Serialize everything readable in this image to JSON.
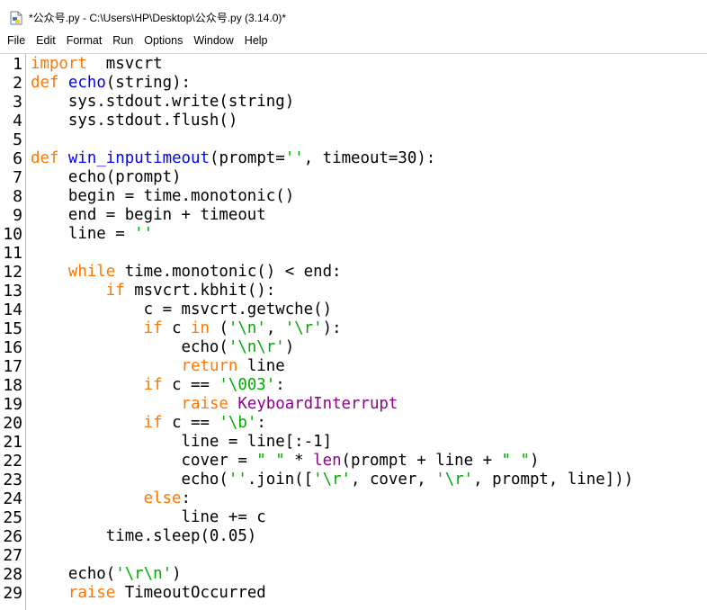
{
  "window": {
    "title": "*公众号.py - C:\\Users\\HP\\Desktop\\公众号.py (3.14.0)*",
    "icon": "python-file-icon"
  },
  "menubar": {
    "items": [
      "File",
      "Edit",
      "Format",
      "Run",
      "Options",
      "Window",
      "Help"
    ]
  },
  "editor": {
    "colors": {
      "keyword": "#ff7700",
      "builtin": "#900090",
      "string": "#00aa00",
      "definition": "#0000ff",
      "text": "#000000"
    },
    "lines": [
      [
        [
          "kw",
          "import"
        ],
        [
          "",
          "  msvcrt"
        ]
      ],
      [
        [
          "kw",
          "def"
        ],
        [
          "",
          " "
        ],
        [
          "df",
          "echo"
        ],
        [
          "",
          "(string):"
        ]
      ],
      [
        [
          "",
          "    sys.stdout.write(string)"
        ]
      ],
      [
        [
          "",
          "    sys.stdout.flush()"
        ]
      ],
      [],
      [
        [
          "kw",
          "def"
        ],
        [
          "",
          " "
        ],
        [
          "df",
          "win_inputimeout"
        ],
        [
          "",
          "(prompt="
        ],
        [
          "st",
          "''"
        ],
        [
          "",
          ", timeout=30):"
        ]
      ],
      [
        [
          "",
          "    echo(prompt)"
        ]
      ],
      [
        [
          "",
          "    begin = time.monotonic()"
        ]
      ],
      [
        [
          "",
          "    end = begin + timeout"
        ]
      ],
      [
        [
          "",
          "    line = "
        ],
        [
          "st",
          "''"
        ]
      ],
      [],
      [
        [
          "",
          "    "
        ],
        [
          "kw",
          "while"
        ],
        [
          "",
          " time.monotonic() < end:"
        ]
      ],
      [
        [
          "",
          "        "
        ],
        [
          "kw",
          "if"
        ],
        [
          "",
          " msvcrt.kbhit():"
        ]
      ],
      [
        [
          "",
          "            c = msvcrt.getwche()"
        ]
      ],
      [
        [
          "",
          "            "
        ],
        [
          "kw",
          "if"
        ],
        [
          "",
          " c "
        ],
        [
          "kw",
          "in"
        ],
        [
          "",
          " ("
        ],
        [
          "st",
          "'\\n'"
        ],
        [
          "",
          ", "
        ],
        [
          "st",
          "'\\r'"
        ],
        [
          "",
          "):"
        ]
      ],
      [
        [
          "",
          "                echo("
        ],
        [
          "st",
          "'\\n\\r'"
        ],
        [
          "",
          ")"
        ]
      ],
      [
        [
          "",
          "                "
        ],
        [
          "kw",
          "return"
        ],
        [
          "",
          " line"
        ]
      ],
      [
        [
          "",
          "            "
        ],
        [
          "kw",
          "if"
        ],
        [
          "",
          " c == "
        ],
        [
          "st",
          "'\\003'"
        ],
        [
          "",
          ":"
        ]
      ],
      [
        [
          "",
          "                "
        ],
        [
          "kw",
          "raise"
        ],
        [
          "",
          " "
        ],
        [
          "bi",
          "KeyboardInterrupt"
        ]
      ],
      [
        [
          "",
          "            "
        ],
        [
          "kw",
          "if"
        ],
        [
          "",
          " c == "
        ],
        [
          "st",
          "'\\b'"
        ],
        [
          "",
          ":"
        ]
      ],
      [
        [
          "",
          "                line = line[:-1]"
        ]
      ],
      [
        [
          "",
          "                cover = "
        ],
        [
          "st",
          "\" \""
        ],
        [
          "",
          " * "
        ],
        [
          "bi",
          "len"
        ],
        [
          "",
          "(prompt + line + "
        ],
        [
          "st",
          "\" \""
        ],
        [
          "",
          ")"
        ]
      ],
      [
        [
          "",
          "                echo("
        ],
        [
          "st",
          "''"
        ],
        [
          "",
          ".join(["
        ],
        [
          "st",
          "'\\r'"
        ],
        [
          "",
          ", cover, "
        ],
        [
          "st",
          "'\\r'"
        ],
        [
          "",
          ", prompt, line]))"
        ]
      ],
      [
        [
          "",
          "            "
        ],
        [
          "kw",
          "else"
        ],
        [
          "",
          ":"
        ]
      ],
      [
        [
          "",
          "                line += c"
        ]
      ],
      [
        [
          "",
          "        time.sleep(0.05)"
        ]
      ],
      [],
      [
        [
          "",
          "    echo("
        ],
        [
          "st",
          "'\\r\\n'"
        ],
        [
          "",
          ")"
        ]
      ],
      [
        [
          "",
          "    "
        ],
        [
          "kw",
          "raise"
        ],
        [
          "",
          " TimeoutOccurred"
        ]
      ]
    ]
  }
}
